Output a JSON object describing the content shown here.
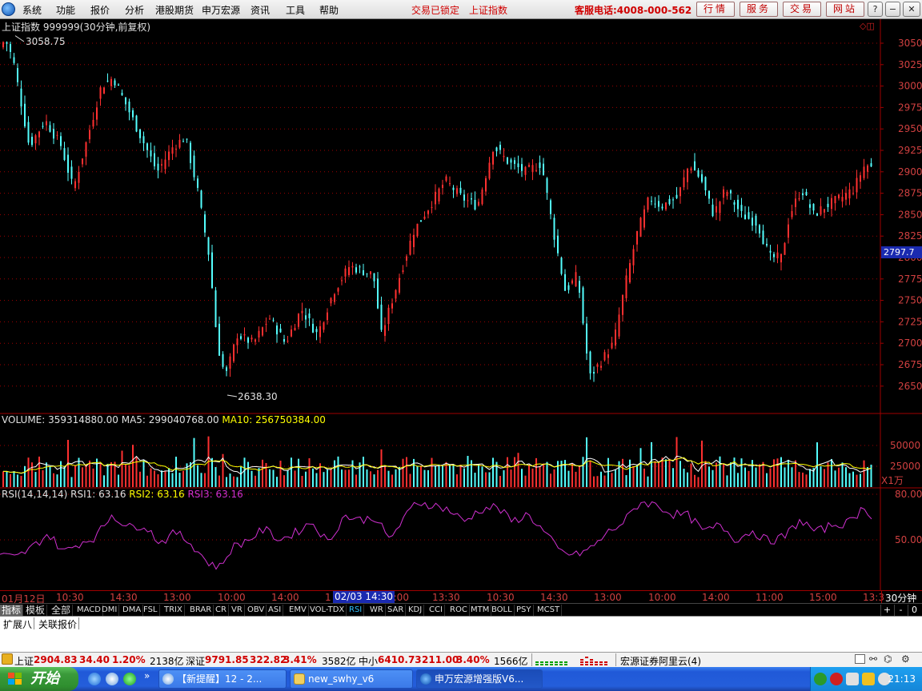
{
  "menu": {
    "items": [
      "系统",
      "功能",
      "报价",
      "分析",
      "港股期货",
      "申万宏源",
      "资讯",
      "工具",
      "帮助"
    ],
    "lock_status": "交易已锁定",
    "current_index": "上证指数",
    "hotline": "客服电话:4008-000-562",
    "buttons": [
      "行情",
      "服务",
      "交易",
      "网站"
    ]
  },
  "window_buttons": {
    "help": "?",
    "minimize": "−",
    "restore": "❐",
    "close": "✕"
  },
  "colors": {
    "up": "#ff3030",
    "down": "#54ffff",
    "ma5": "#ffffff",
    "ma10": "#ffff00",
    "rsi": "#d030d0",
    "grid": "#a00000",
    "axis_text": "#d04040"
  },
  "kline": {
    "title": "上证指数 999999(30分钟,前复权)",
    "high_label": "3058.75",
    "low_label": "2638.30",
    "last_price_tag": "2797.7",
    "y_ticks": [
      "3050",
      "3025",
      "3000",
      "2975",
      "2950",
      "2925",
      "2900",
      "2875",
      "2850",
      "2825",
      "2800",
      "2775",
      "2750",
      "2725",
      "2700",
      "2675",
      "2650"
    ]
  },
  "volume": {
    "label": "VOLUME: 359314880.00",
    "ma5_label": "MA5: 299040768.00",
    "ma10_label": "MA10: 256750384.00",
    "y_ticks": [
      "50000",
      "25000"
    ],
    "unit": "X1万"
  },
  "rsi": {
    "label": "RSI(14,14,14)",
    "rsi1_label": "RSI1: 63.16",
    "rsi2_label": "RSI2: 63.16",
    "rsi3_label": "RSI3: 63.16",
    "y_ticks": [
      "80.00",
      "50.00"
    ]
  },
  "time_axis": {
    "labels": [
      "01月12日",
      "10:30",
      "14:30",
      "13:00",
      "10:00",
      "14:00",
      "1",
      "6:00",
      "13:30",
      "10:30",
      "14:30",
      "13:00",
      "10:00",
      "14:00",
      "11:00",
      "15:00",
      "13:3"
    ],
    "cursor_label": "02/03 14:30",
    "period": "30分钟"
  },
  "indicator_tabs": [
    "指标",
    "模板",
    "全部",
    "MACD",
    "DMI",
    "DMA",
    "FSL",
    "TRIX",
    "BRAR",
    "CR",
    "VR",
    "OBV",
    "ASI",
    "EMV",
    "VOL-TDX",
    "RSI",
    "WR",
    "SAR",
    "KDJ",
    "CCI",
    "ROC",
    "MTM",
    "BOLL",
    "PSY",
    "MCST"
  ],
  "tab_controls": [
    "+",
    "-",
    "0"
  ],
  "sub_tabs": [
    "扩展八",
    "关联报价"
  ],
  "statusbar": {
    "sh_name": "上证",
    "sh_value": "2904.83",
    "sh_change": "34.40",
    "sh_pct": "1.20%",
    "sh_amount": "2138亿",
    "sz_name": "深证",
    "sz_value": "9791.85",
    "sz_change": "322.82",
    "sz_pct": "3.41%",
    "sz_amount": "3582亿",
    "zx_name": "中小",
    "zx_value": "6410.73",
    "zx_change": "211.00",
    "zx_pct": "3.40%",
    "zx_amount": "1566亿",
    "server": "宏源证券阿里云(4)"
  },
  "taskbar": {
    "start": "开始",
    "quick_chevron": "»",
    "items": [
      "【新提醒】12 - 2...",
      "new_swhy_v6",
      "申万宏源增强版V6..."
    ],
    "clock": "21:13"
  }
}
